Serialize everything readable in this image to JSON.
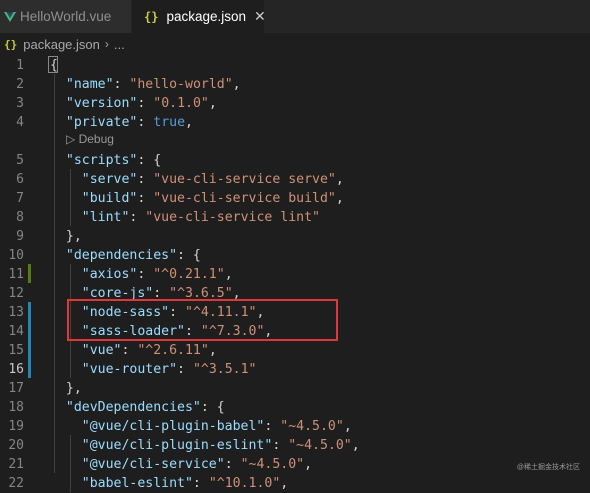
{
  "tabs": [
    {
      "label": "HelloWorld.vue"
    },
    {
      "label": "package.json",
      "icon_text": "{}",
      "close": "✕"
    }
  ],
  "breadcrumb": {
    "icon_text": "{}",
    "file": "package.json",
    "sep": "›",
    "rest": "..."
  },
  "codelens": {
    "label": "▷ Debug"
  },
  "colors": {
    "git_modified": "#2188b6",
    "git_added": "#587c0c",
    "highlight": "#e0373b"
  },
  "lines": [
    {
      "n": "1",
      "tokens": [
        {
          "t": "{",
          "c": "p"
        }
      ]
    },
    {
      "n": "2",
      "tokens": [
        {
          "t": "  "
        },
        {
          "t": "\"name\"",
          "c": "k"
        },
        {
          "t": ": ",
          "c": "p"
        },
        {
          "t": "\"hello-world\"",
          "c": "s"
        },
        {
          "t": ",",
          "c": "p"
        }
      ]
    },
    {
      "n": "3",
      "tokens": [
        {
          "t": "  "
        },
        {
          "t": "\"version\"",
          "c": "k"
        },
        {
          "t": ": ",
          "c": "p"
        },
        {
          "t": "\"0.1.0\"",
          "c": "s"
        },
        {
          "t": ",",
          "c": "p"
        }
      ]
    },
    {
      "n": "4",
      "tokens": [
        {
          "t": "  "
        },
        {
          "t": "\"private\"",
          "c": "k"
        },
        {
          "t": ": ",
          "c": "p"
        },
        {
          "t": "true",
          "c": "b"
        },
        {
          "t": ",",
          "c": "p"
        }
      ]
    },
    {
      "n": "5",
      "tokens": [
        {
          "t": "  "
        },
        {
          "t": "\"scripts\"",
          "c": "k"
        },
        {
          "t": ": {",
          "c": "p"
        }
      ]
    },
    {
      "n": "6",
      "tokens": [
        {
          "t": "    "
        },
        {
          "t": "\"serve\"",
          "c": "k"
        },
        {
          "t": ": ",
          "c": "p"
        },
        {
          "t": "\"vue-cli-service serve\"",
          "c": "s"
        },
        {
          "t": ",",
          "c": "p"
        }
      ]
    },
    {
      "n": "7",
      "tokens": [
        {
          "t": "    "
        },
        {
          "t": "\"build\"",
          "c": "k"
        },
        {
          "t": ": ",
          "c": "p"
        },
        {
          "t": "\"vue-cli-service build\"",
          "c": "s"
        },
        {
          "t": ",",
          "c": "p"
        }
      ]
    },
    {
      "n": "8",
      "tokens": [
        {
          "t": "    "
        },
        {
          "t": "\"lint\"",
          "c": "k"
        },
        {
          "t": ": ",
          "c": "p"
        },
        {
          "t": "\"vue-cli-service lint\"",
          "c": "s"
        }
      ]
    },
    {
      "n": "9",
      "tokens": [
        {
          "t": "  },",
          "c": "p"
        }
      ]
    },
    {
      "n": "10",
      "tokens": [
        {
          "t": "  "
        },
        {
          "t": "\"dependencies\"",
          "c": "k"
        },
        {
          "t": ": {",
          "c": "p"
        }
      ]
    },
    {
      "n": "11",
      "tokens": [
        {
          "t": "    "
        },
        {
          "t": "\"axios\"",
          "c": "k"
        },
        {
          "t": ": ",
          "c": "p"
        },
        {
          "t": "\"^0.21.1\"",
          "c": "s"
        },
        {
          "t": ",",
          "c": "p"
        }
      ]
    },
    {
      "n": "12",
      "tokens": [
        {
          "t": "    "
        },
        {
          "t": "\"core-js\"",
          "c": "k"
        },
        {
          "t": ": ",
          "c": "p"
        },
        {
          "t": "\"^3.6.5\"",
          "c": "s"
        },
        {
          "t": ",",
          "c": "p"
        }
      ]
    },
    {
      "n": "13",
      "tokens": [
        {
          "t": "    "
        },
        {
          "t": "\"node-sass\"",
          "c": "k"
        },
        {
          "t": ": ",
          "c": "p"
        },
        {
          "t": "\"^4.11.1\"",
          "c": "s"
        },
        {
          "t": ",",
          "c": "p"
        }
      ]
    },
    {
      "n": "14",
      "tokens": [
        {
          "t": "    "
        },
        {
          "t": "\"sass-loader\"",
          "c": "k"
        },
        {
          "t": ": ",
          "c": "p"
        },
        {
          "t": "\"^7.3.0\"",
          "c": "s"
        },
        {
          "t": ",",
          "c": "p"
        }
      ]
    },
    {
      "n": "15",
      "tokens": [
        {
          "t": "    "
        },
        {
          "t": "\"vue\"",
          "c": "k"
        },
        {
          "t": ": ",
          "c": "p"
        },
        {
          "t": "\"^2.6.11\"",
          "c": "s"
        },
        {
          "t": ",",
          "c": "p"
        }
      ]
    },
    {
      "n": "16",
      "tokens": [
        {
          "t": "    "
        },
        {
          "t": "\"vue-router\"",
          "c": "k"
        },
        {
          "t": ": ",
          "c": "p"
        },
        {
          "t": "\"^3.5.1\"",
          "c": "s"
        }
      ]
    },
    {
      "n": "17",
      "tokens": [
        {
          "t": "  },",
          "c": "p"
        }
      ]
    },
    {
      "n": "18",
      "tokens": [
        {
          "t": "  "
        },
        {
          "t": "\"devDependencies\"",
          "c": "k"
        },
        {
          "t": ": {",
          "c": "p"
        }
      ]
    },
    {
      "n": "19",
      "tokens": [
        {
          "t": "    "
        },
        {
          "t": "\"@vue/cli-plugin-babel\"",
          "c": "k"
        },
        {
          "t": ": ",
          "c": "p"
        },
        {
          "t": "\"~4.5.0\"",
          "c": "s"
        },
        {
          "t": ",",
          "c": "p"
        }
      ]
    },
    {
      "n": "20",
      "tokens": [
        {
          "t": "    "
        },
        {
          "t": "\"@vue/cli-plugin-eslint\"",
          "c": "k"
        },
        {
          "t": ": ",
          "c": "p"
        },
        {
          "t": "\"~4.5.0\"",
          "c": "s"
        },
        {
          "t": ",",
          "c": "p"
        }
      ]
    },
    {
      "n": "21",
      "tokens": [
        {
          "t": "    "
        },
        {
          "t": "\"@vue/cli-service\"",
          "c": "k"
        },
        {
          "t": ": ",
          "c": "p"
        },
        {
          "t": "\"~4.5.0\"",
          "c": "s"
        },
        {
          "t": ",",
          "c": "p"
        }
      ]
    },
    {
      "n": "22",
      "tokens": [
        {
          "t": "    "
        },
        {
          "t": "\"babel-eslint\"",
          "c": "k"
        },
        {
          "t": ": ",
          "c": "p"
        },
        {
          "t": "\"^10.1.0\"",
          "c": "s"
        },
        {
          "t": ",",
          "c": "p"
        }
      ]
    }
  ],
  "watermark": "@稀土掘金技术社区"
}
